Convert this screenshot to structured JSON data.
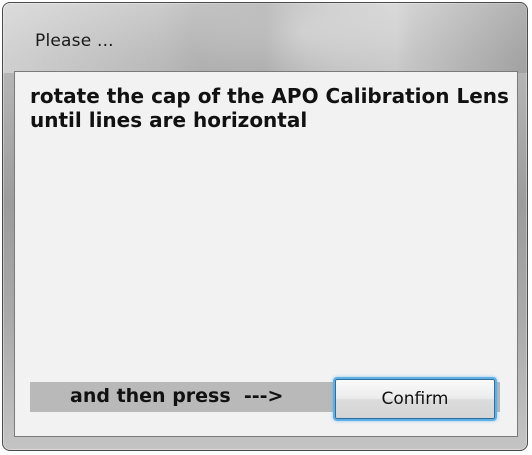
{
  "window": {
    "title": "Please ..."
  },
  "dialog": {
    "message": "rotate the cap of the APO Calibration Lens until lines are horizontal",
    "prompt": "and then press  --->",
    "confirm_label": "Confirm"
  },
  "colors": {
    "client_background": "#f2f2f2",
    "prompt_bar": "#b9b9b9",
    "button_focus_border": "#5db0e6"
  }
}
